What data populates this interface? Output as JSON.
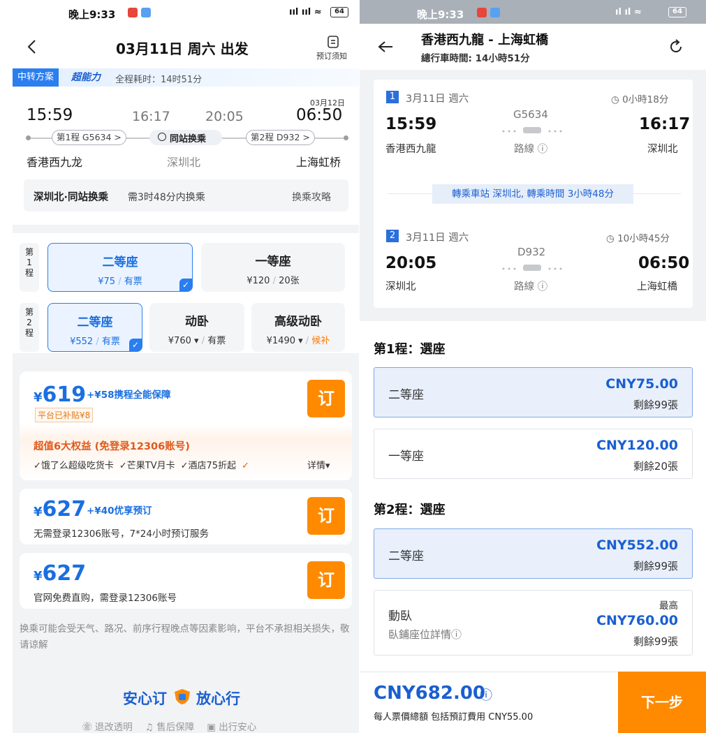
{
  "left": {
    "status": {
      "time": "晚上9:33",
      "signal": "ııl ııl ≈",
      "battery": "64"
    },
    "header": {
      "title": "03月11日 周六 出发",
      "notice_label": "预订须知"
    },
    "banner": {
      "tag": "中转方案",
      "brand": "超能力",
      "total_time": "全程耗时：14时51分"
    },
    "journey": {
      "arrive_date": "03月12日",
      "depart_time": "15:59",
      "transfer_arrive_time": "16:17",
      "transfer_depart_time": "20:05",
      "arrive_time": "06:50",
      "leg1_pill": "第1程 G5634 >",
      "transfer_pill": "同站换乘",
      "leg2_pill": "第2程 D932 >",
      "from_station": "香港西九龙",
      "via_station": "深圳北",
      "to_station": "上海虹桥"
    },
    "transfer_box": {
      "title": "深圳北·同站换乘",
      "detail": "需3时48分内换乘",
      "guide_link": "换乘攻略"
    },
    "leg1_seats": {
      "label": "第\n1\n程",
      "seats": [
        {
          "name": "二等座",
          "price": "¥75",
          "avail": "有票"
        },
        {
          "name": "一等座",
          "price": "¥120",
          "avail": "20张"
        }
      ]
    },
    "leg2_seats": {
      "label": "第\n2\n程",
      "seats": [
        {
          "name": "二等座",
          "price": "¥552",
          "avail": "有票"
        },
        {
          "name": "动卧",
          "price": "¥760 ▾",
          "avail": "有票"
        },
        {
          "name": "高级动卧",
          "price": "¥1490 ▾",
          "avail": "候补"
        }
      ]
    },
    "options": [
      {
        "currency": "¥",
        "price": "619",
        "extra": "+¥58携程全能保障",
        "subsidy": "平台已补贴¥8",
        "benefits_title": "超值6大权益 (免登录12306账号)",
        "benefits": [
          "✓饿了么超级吃货卡",
          "✓芒果TV月卡",
          "✓酒店75折起",
          "✓"
        ],
        "details": "详情▾",
        "book": "订"
      },
      {
        "currency": "¥",
        "price": "627",
        "extra": "+¥40优享预订",
        "desc": "无需登录12306账号，7*24小时预订服务",
        "book": "订"
      },
      {
        "currency": "¥",
        "price": "627",
        "desc": "官网免费直购，需登录12306账号",
        "book": "订"
      }
    ],
    "disclaimer": "换乘可能会受天气、路况、前序行程晚点等因素影响，平台不承担相关损失，敬请谅解",
    "footer": {
      "slogan_left": "安心订",
      "slogan_right": "放心行",
      "items": [
        "退改透明",
        "售后保障",
        "出行安心"
      ]
    }
  },
  "right": {
    "status": {
      "time": "晚上9:33",
      "signal": "ıl ıl ≈",
      "battery": "64"
    },
    "header": {
      "title": "香港西九龍 - 上海虹橋",
      "subtitle": "總行車時間: 14小時51分"
    },
    "legs": [
      {
        "num": "1",
        "date": "3月11日 週六",
        "duration": "0小時18分",
        "train": "G5634",
        "dep_time": "15:59",
        "arr_time": "16:17",
        "dep_station": "香港西九龍",
        "arr_station": "深圳北",
        "route": "路線 ⓘ"
      },
      {
        "num": "2",
        "date": "3月11日 週六",
        "duration": "10小時45分",
        "train": "D932",
        "dep_time": "20:05",
        "arr_time": "06:50",
        "dep_station": "深圳北",
        "arr_station": "上海虹橋",
        "route": "路線 ⓘ"
      }
    ],
    "transfer": "轉乘車站 深圳北, 轉乘時間 3小時48分",
    "leg1_title": "第1程：選座",
    "leg1_seats": [
      {
        "name": "二等座",
        "price": "CNY75.00",
        "remain": "剩餘99張"
      },
      {
        "name": "一等座",
        "price": "CNY120.00",
        "remain": "剩餘20張"
      }
    ],
    "leg2_title": "第2程：選座",
    "leg2_seats": [
      {
        "name": "二等座",
        "price": "CNY552.00",
        "remain": "剩餘99張"
      },
      {
        "name": "動臥",
        "sub": "臥鋪座位詳情ⓘ",
        "top": "最高",
        "price": "CNY760.00",
        "remain": "剩餘99張"
      }
    ],
    "bottom": {
      "total": "CNY682.00",
      "info": "ⓘ",
      "desc": "每人票價總額 包括預訂費用 CNY55.00",
      "next": "下一步"
    }
  }
}
